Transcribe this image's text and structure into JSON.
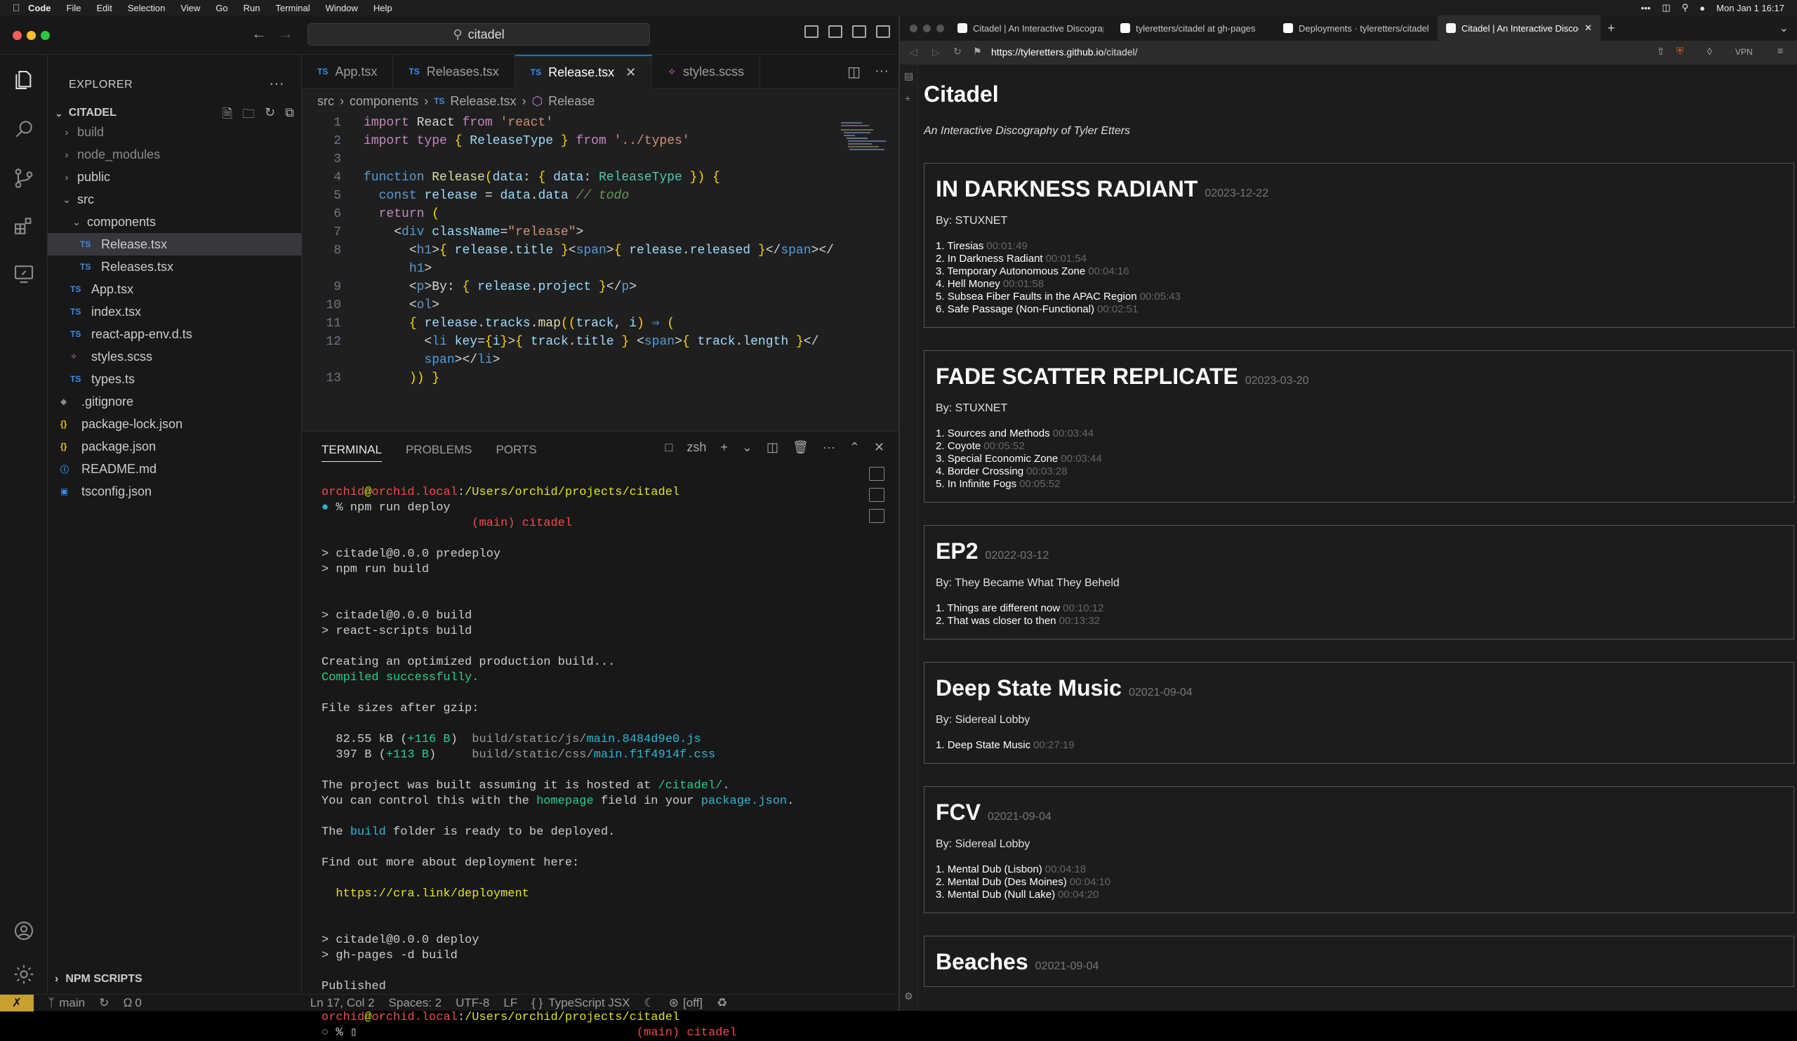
{
  "menubar": {
    "app": "Code",
    "items": [
      "File",
      "Edit",
      "Selection",
      "View",
      "Go",
      "Run",
      "Terminal",
      "Window",
      "Help"
    ],
    "clock": "Mon Jan 1  16:17"
  },
  "vscode": {
    "search_label": "citadel",
    "explorer": {
      "header": "EXPLORER",
      "project": "CITADEL",
      "tree": [
        {
          "label": "build",
          "kind": "folder",
          "depth": 1,
          "dim": true
        },
        {
          "label": "node_modules",
          "kind": "folder",
          "depth": 1,
          "dim": true
        },
        {
          "label": "public",
          "kind": "folder",
          "depth": 1
        },
        {
          "label": "src",
          "kind": "folder-open",
          "depth": 1
        },
        {
          "label": "components",
          "kind": "folder-open",
          "depth": 2
        },
        {
          "label": "Release.tsx",
          "kind": "ts",
          "depth": 3,
          "selected": true
        },
        {
          "label": "Releases.tsx",
          "kind": "ts",
          "depth": 3
        },
        {
          "label": "App.tsx",
          "kind": "ts",
          "depth": 2
        },
        {
          "label": "index.tsx",
          "kind": "ts",
          "depth": 2
        },
        {
          "label": "react-app-env.d.ts",
          "kind": "ts",
          "depth": 2
        },
        {
          "label": "styles.scss",
          "kind": "scss",
          "depth": 2
        },
        {
          "label": "types.ts",
          "kind": "ts",
          "depth": 2
        },
        {
          "label": ".gitignore",
          "kind": "git",
          "depth": 1
        },
        {
          "label": "package-lock.json",
          "kind": "json",
          "depth": 1
        },
        {
          "label": "package.json",
          "kind": "json",
          "depth": 1
        },
        {
          "label": "README.md",
          "kind": "info",
          "depth": 1
        },
        {
          "label": "tsconfig.json",
          "kind": "tsconfig",
          "depth": 1
        }
      ],
      "npm_scripts": "NPM SCRIPTS"
    },
    "tabs": [
      {
        "label": "App.tsx",
        "kind": "ts"
      },
      {
        "label": "Releases.tsx",
        "kind": "ts"
      },
      {
        "label": "Release.tsx",
        "kind": "ts",
        "active": true
      },
      {
        "label": "styles.scss",
        "kind": "scss"
      }
    ],
    "breadcrumb": [
      "src",
      "components",
      "Release.tsx",
      "Release"
    ],
    "panel": {
      "tabs": [
        "TERMINAL",
        "PROBLEMS",
        "PORTS"
      ],
      "shell": "zsh"
    },
    "status": {
      "branch": "main",
      "errors": "0",
      "position": "Ln 17, Col 2",
      "spaces": "Spaces: 2",
      "encoding": "UTF-8",
      "eol": "LF",
      "language": "TypeScript JSX",
      "copilot": "[off]"
    }
  },
  "browser": {
    "tabs": [
      {
        "label": "Citadel | An Interactive Discography",
        "fav": "#f5f5f5"
      },
      {
        "label": "tyleretters/citadel at gh-pages",
        "fav": "#ffffff"
      },
      {
        "label": "Deployments · tyleretters/citadel",
        "fav": "#ffffff"
      },
      {
        "label": "Citadel | An Interactive Discography",
        "fav": "#f5f5f5",
        "active": true
      }
    ],
    "url_host": "https://tyleretters.github.io",
    "url_path": "/citadel/",
    "vpn": "VPN",
    "site": {
      "title": "Citadel",
      "subtitle": "An Interactive Discography of Tyler Etters",
      "albums": [
        {
          "title": "IN DARKNESS RADIANT",
          "date": "02023-12-22",
          "by": "By: STUXNET",
          "tracks": [
            {
              "n": "1.",
              "t": "Tiresias",
              "l": "00:01:49"
            },
            {
              "n": "2.",
              "t": "In Darkness Radiant",
              "l": "00:01:54"
            },
            {
              "n": "3.",
              "t": "Temporary Autonomous Zone",
              "l": "00:04:16"
            },
            {
              "n": "4.",
              "t": "Hell Money",
              "l": "00:01:58"
            },
            {
              "n": "5.",
              "t": "Subsea Fiber Faults in the APAC Region",
              "l": "00:05:43"
            },
            {
              "n": "6.",
              "t": "Safe Passage (Non-Functional)",
              "l": "00:02:51"
            }
          ]
        },
        {
          "title": "FADE SCATTER REPLICATE",
          "date": "02023-03-20",
          "by": "By: STUXNET",
          "tracks": [
            {
              "n": "1.",
              "t": "Sources and Methods",
              "l": "00:03:44"
            },
            {
              "n": "2.",
              "t": "Coyote",
              "l": "00:05:52"
            },
            {
              "n": "3.",
              "t": "Special Economic Zone",
              "l": "00:03:44"
            },
            {
              "n": "4.",
              "t": "Border Crossing",
              "l": "00:03:28"
            },
            {
              "n": "5.",
              "t": "In Infinite Fogs",
              "l": "00:05:52"
            }
          ]
        },
        {
          "title": "EP2",
          "date": "02022-03-12",
          "by": "By: They Became What They Beheld",
          "tracks": [
            {
              "n": "1.",
              "t": "Things are different now",
              "l": "00:10:12"
            },
            {
              "n": "2.",
              "t": "That was closer to then",
              "l": "00:13:32"
            }
          ]
        },
        {
          "title": "Deep State Music",
          "date": "02021-09-04",
          "by": "By: Sidereal Lobby",
          "tracks": [
            {
              "n": "1.",
              "t": "Deep State Music",
              "l": "00:27:19"
            }
          ]
        },
        {
          "title": "FCV",
          "date": "02021-09-04",
          "by": "By: Sidereal Lobby",
          "tracks": [
            {
              "n": "1.",
              "t": "Mental Dub (Lisbon)",
              "l": "00:04:18"
            },
            {
              "n": "2.",
              "t": "Mental Dub (Des Moines)",
              "l": "00:04:10"
            },
            {
              "n": "3.",
              "t": "Mental Dub (Null Lake)",
              "l": "00:04:20"
            }
          ]
        },
        {
          "title": "Beaches",
          "date": "02021-09-04",
          "by": "",
          "tracks": []
        }
      ]
    }
  }
}
